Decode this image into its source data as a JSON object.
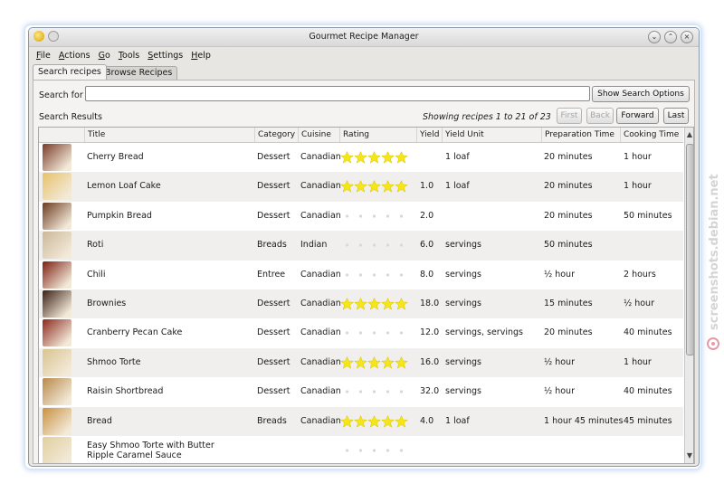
{
  "window": {
    "title": "Gourmet Recipe Manager"
  },
  "menu": [
    {
      "label": "File",
      "ul": "F",
      "rest": "ile"
    },
    {
      "label": "Actions",
      "ul": "A",
      "rest": "ctions"
    },
    {
      "label": "Go",
      "ul": "G",
      "rest": "o"
    },
    {
      "label": "Tools",
      "ul": "T",
      "rest": "ools"
    },
    {
      "label": "Settings",
      "ul": "S",
      "rest": "ettings"
    },
    {
      "label": "Help",
      "ul": "H",
      "rest": "elp"
    }
  ],
  "tabs": {
    "search": "Search recipes",
    "browse": "Browse Recipes"
  },
  "search": {
    "label": "Search for",
    "value": "",
    "options_button": "Show Search Options"
  },
  "results": {
    "label": "Search Results",
    "showing": "Showing recipes 1 to 21 of 23",
    "first": "First",
    "back": "Back",
    "forward": "Forward",
    "last": "Last"
  },
  "columns": {
    "title": "Title",
    "category": "Category",
    "cuisine": "Cuisine",
    "rating": "Rating",
    "yield": "Yield",
    "yield_unit": "Yield Unit",
    "prep": "Preparation Time",
    "cook": "Cooking Time"
  },
  "colors": {
    "star_full": "#f5e61a",
    "star_empty": "#d8d8d8"
  },
  "recipes": [
    {
      "title": "Cherry Bread",
      "category": "Dessert",
      "cuisine": "Canadian",
      "rating": 5,
      "yield": "",
      "yield_unit": "1 loaf",
      "prep": "20 minutes",
      "cook": "1 hour",
      "thumb": "#7a3b2a"
    },
    {
      "title": "Lemon Loaf Cake",
      "category": "Dessert",
      "cuisine": "Canadian",
      "rating": 5,
      "yield": "1.0",
      "yield_unit": "1 loaf",
      "prep": "20 minutes",
      "cook": "1 hour",
      "thumb": "#e8c26a"
    },
    {
      "title": "Pumpkin Bread",
      "category": "Dessert",
      "cuisine": "Canadian",
      "rating": 0,
      "yield": "2.0",
      "yield_unit": "",
      "prep": "20 minutes",
      "cook": "50 minutes",
      "thumb": "#6b3a1f"
    },
    {
      "title": "Roti",
      "category": "Breads",
      "cuisine": "Indian",
      "rating": 0,
      "yield": "6.0",
      "yield_unit": "servings",
      "prep": "50 minutes",
      "cook": "",
      "thumb": "#cbb79a"
    },
    {
      "title": "Chili",
      "category": "Entree",
      "cuisine": "Canadian",
      "rating": 0,
      "yield": "8.0",
      "yield_unit": "servings",
      "prep": "½ hour",
      "cook": "2 hours",
      "thumb": "#7d1f12"
    },
    {
      "title": "Brownies",
      "category": "Dessert",
      "cuisine": "Canadian",
      "rating": 5,
      "yield": "18.0",
      "yield_unit": "servings",
      "prep": "15 minutes",
      "cook": "½ hour",
      "thumb": "#3b2016"
    },
    {
      "title": "Cranberry Pecan Cake",
      "category": "Dessert",
      "cuisine": "Canadian",
      "rating": 0,
      "yield": "12.0",
      "yield_unit": "servings, servings",
      "prep": "20 minutes",
      "cook": "40 minutes",
      "thumb": "#8c2a1e"
    },
    {
      "title": "Shmoo Torte",
      "category": "Dessert",
      "cuisine": "Canadian",
      "rating": 5,
      "yield": "16.0",
      "yield_unit": "servings",
      "prep": "½ hour",
      "cook": "1 hour",
      "thumb": "#d9c48f"
    },
    {
      "title": "Raisin Shortbread",
      "category": "Dessert",
      "cuisine": "Canadian",
      "rating": 0,
      "yield": "32.0",
      "yield_unit": "servings",
      "prep": "½ hour",
      "cook": "40 minutes",
      "thumb": "#b98a4a"
    },
    {
      "title": "Bread",
      "category": "Breads",
      "cuisine": "Canadian",
      "rating": 5,
      "yield": "4.0",
      "yield_unit": "1 loaf",
      "prep": "1 hour 45 minutes",
      "cook": "45 minutes",
      "thumb": "#c9913f"
    },
    {
      "title": "Easy Shmoo Torte with Butter Ripple Caramel Sauce",
      "category": "",
      "cuisine": "",
      "rating": 0,
      "yield": "",
      "yield_unit": "",
      "prep": "",
      "cook": "",
      "thumb": "#e0cf9f"
    }
  ],
  "watermark": "screenshots.debian.net"
}
